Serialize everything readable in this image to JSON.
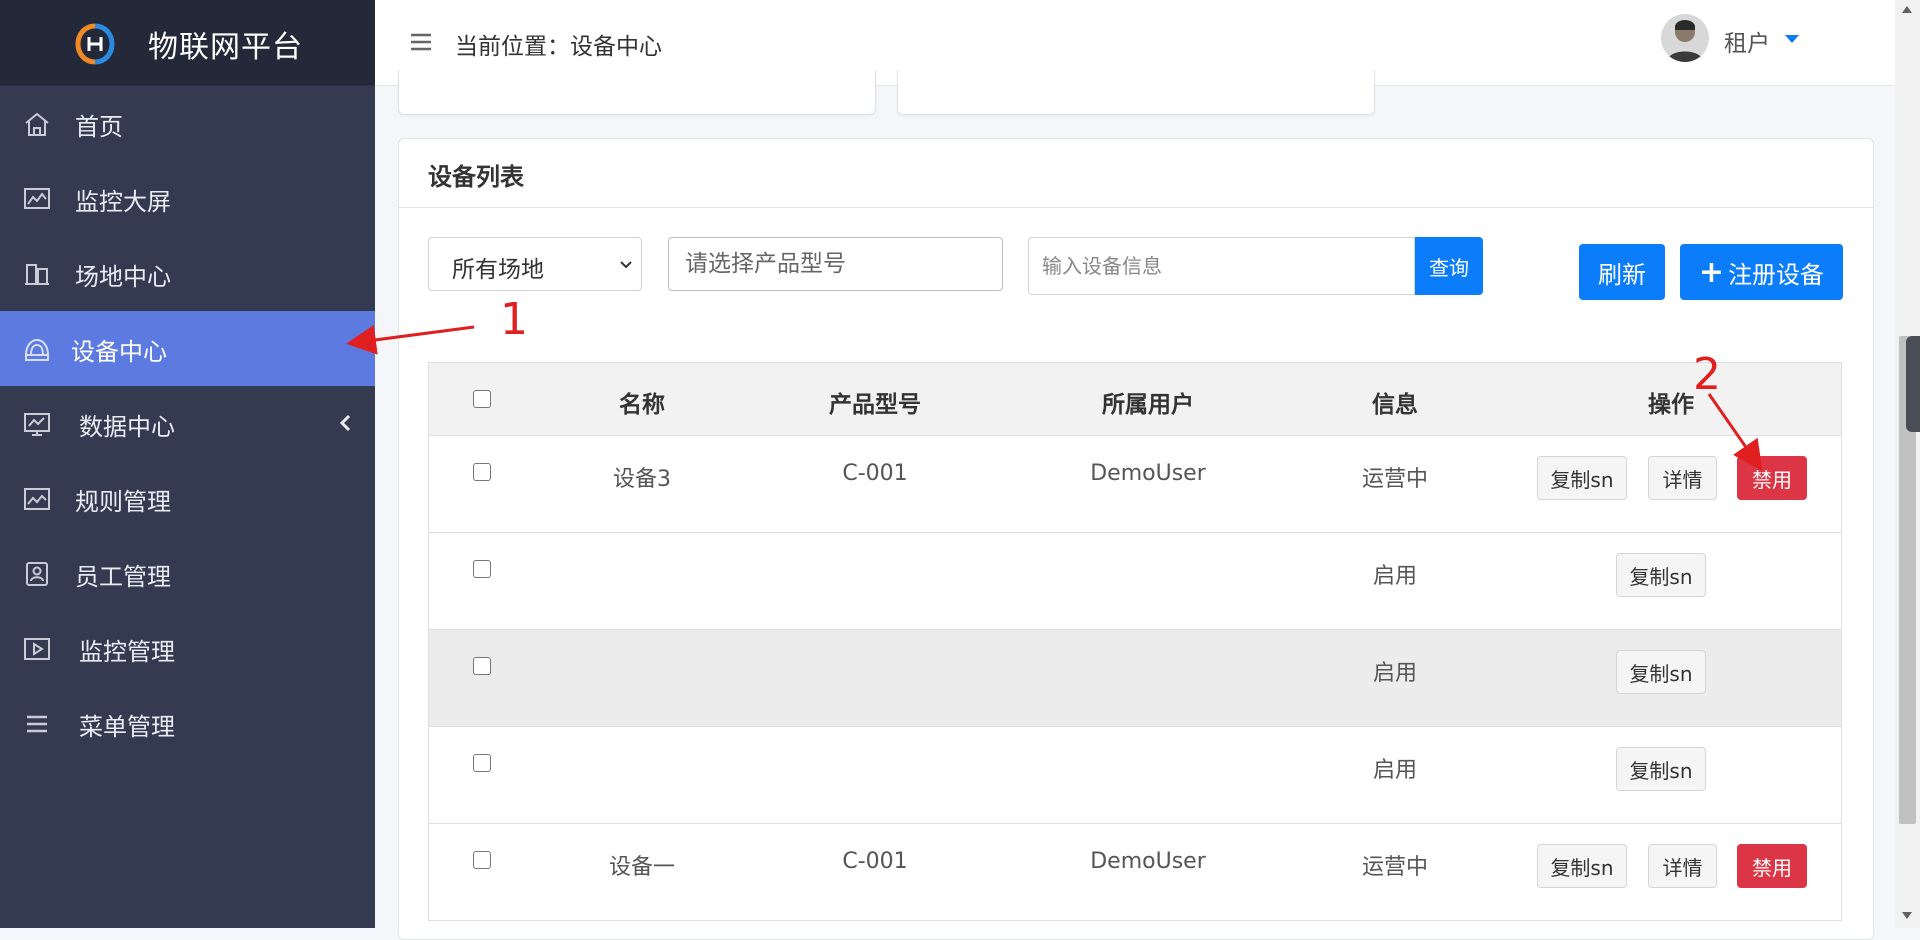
{
  "app": {
    "title": "物联网平台"
  },
  "sidebar": {
    "items": [
      {
        "label": "首页",
        "icon": "home-icon"
      },
      {
        "label": "监控大屏",
        "icon": "monitor-chart-icon"
      },
      {
        "label": "场地中心",
        "icon": "buildings-icon"
      },
      {
        "label": "设备中心",
        "icon": "device-icon",
        "active": true
      },
      {
        "label": "数据中心",
        "icon": "data-chart-icon",
        "has_submenu": true
      },
      {
        "label": "规则管理",
        "icon": "rules-icon"
      },
      {
        "label": "员工管理",
        "icon": "employee-icon"
      },
      {
        "label": "监控管理",
        "icon": "video-play-icon"
      },
      {
        "label": "菜单管理",
        "icon": "menu-list-icon"
      }
    ]
  },
  "header": {
    "breadcrumb": "当前位置：设备中心",
    "user_name": "租户"
  },
  "device_list": {
    "title": "设备列表",
    "filter_site": "所有场地",
    "product_placeholder": "请选择产品型号",
    "device_placeholder": "输入设备信息",
    "query_label": "查询",
    "refresh_label": "刷新",
    "register_label": "注册设备",
    "columns": [
      "名称",
      "产品型号",
      "所属用户",
      "信息",
      "操作"
    ],
    "rows": [
      {
        "name": "设备3",
        "model": "C-001",
        "user": "DemoUser",
        "info": "运营中",
        "actions": [
          "复制sn",
          "详情",
          "禁用"
        ]
      },
      {
        "name": "",
        "model": "",
        "user": "",
        "info": "启用",
        "actions": [
          "复制sn"
        ]
      },
      {
        "name": "",
        "model": "",
        "user": "",
        "info": "启用",
        "actions": [
          "复制sn"
        ]
      },
      {
        "name": "",
        "model": "",
        "user": "",
        "info": "启用",
        "actions": [
          "复制sn"
        ]
      },
      {
        "name": "设备一",
        "model": "C-001",
        "user": "DemoUser",
        "info": "运营中",
        "actions": [
          "复制sn",
          "详情",
          "禁用"
        ]
      }
    ]
  },
  "annotations": {
    "label_1": "1",
    "label_2": "2"
  },
  "colors": {
    "sidebar_bg": "#343a50",
    "sidebar_active": "#5c7ae0",
    "primary": "#0b7dfa",
    "danger": "#dc3545",
    "annotation": "#e02020"
  }
}
